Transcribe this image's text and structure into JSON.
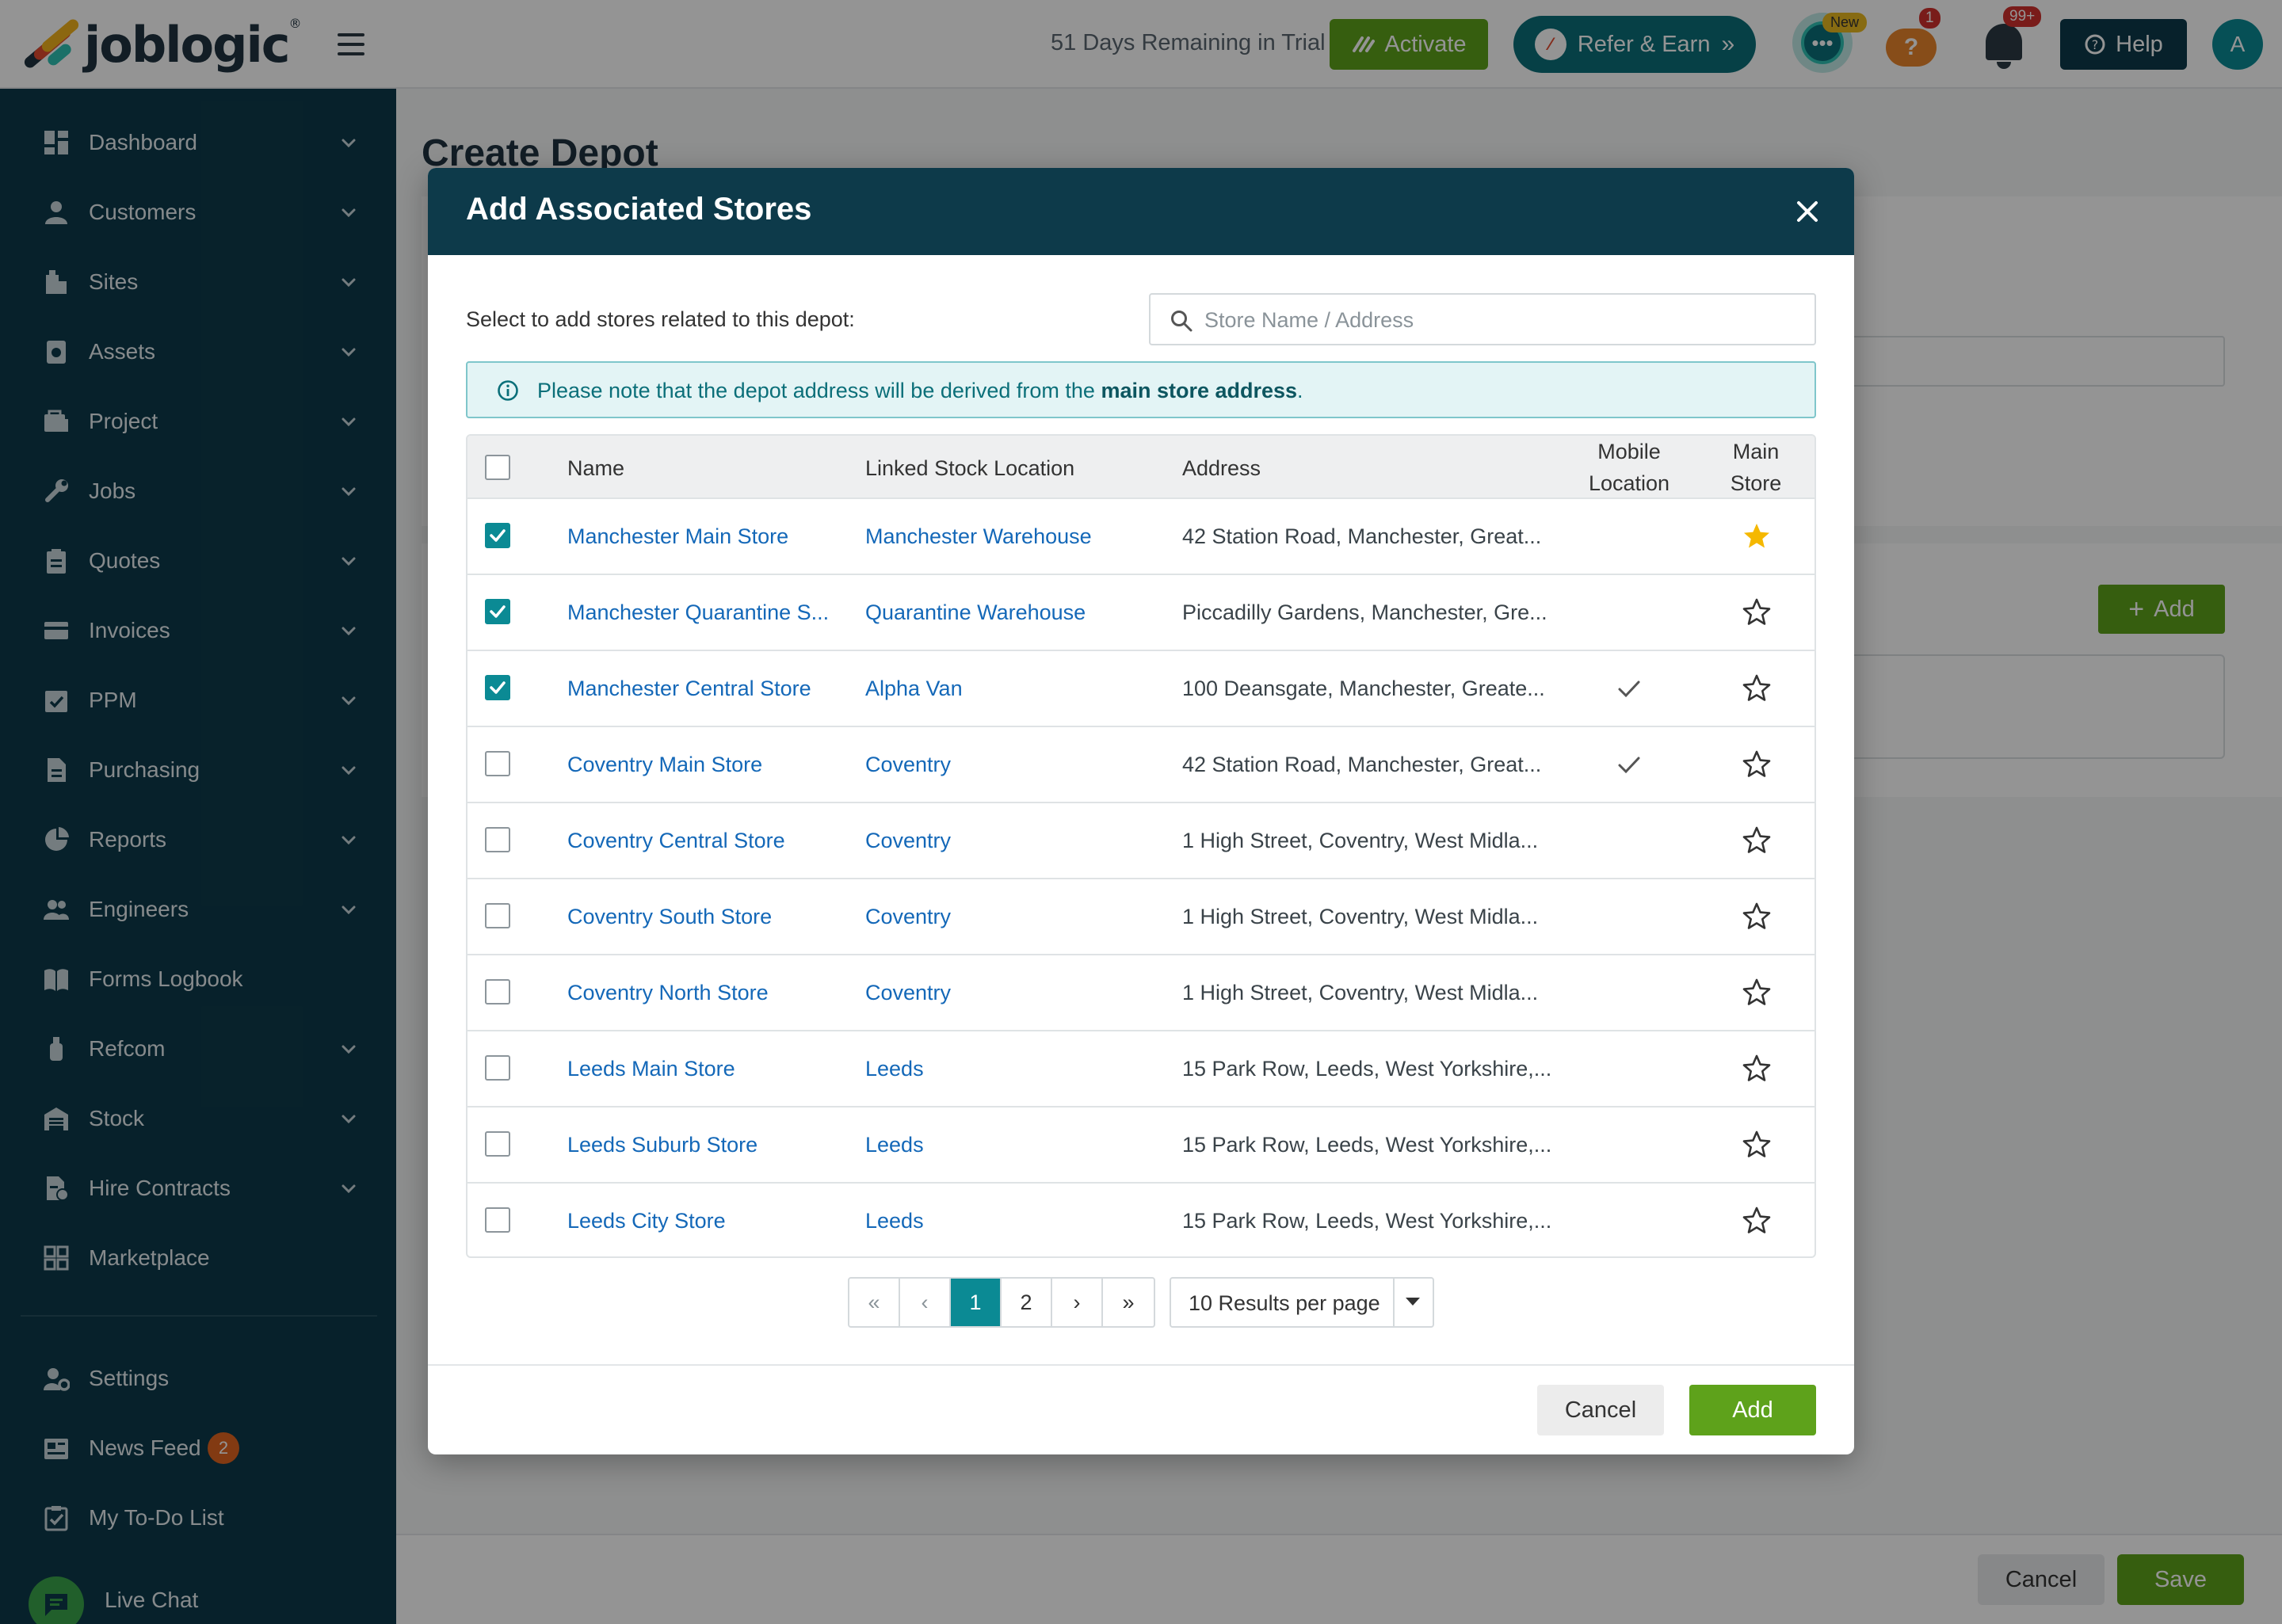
{
  "app": {
    "logo_text": "joblogic",
    "logo_registered": "®"
  },
  "topbar": {
    "trial_text": "51 Days Remaining in Trial",
    "activate_label": "Activate",
    "refer_label": "Refer & Earn",
    "chat_new_badge": "New",
    "help_count": "1",
    "notifications_count": "99+",
    "help_label": "Help",
    "avatar_initial": "A"
  },
  "sidebar": {
    "items": [
      {
        "label": "Dashboard",
        "icon": "dashboard-icon",
        "chevron": true
      },
      {
        "label": "Customers",
        "icon": "person-icon",
        "chevron": true
      },
      {
        "label": "Sites",
        "icon": "building-icon",
        "chevron": true
      },
      {
        "label": "Assets",
        "icon": "asset-icon",
        "chevron": true
      },
      {
        "label": "Project",
        "icon": "project-icon",
        "chevron": true
      },
      {
        "label": "Jobs",
        "icon": "wrench-icon",
        "chevron": true
      },
      {
        "label": "Quotes",
        "icon": "clipboard-icon",
        "chevron": true
      },
      {
        "label": "Invoices",
        "icon": "card-icon",
        "chevron": true
      },
      {
        "label": "PPM",
        "icon": "calendar-check-icon",
        "chevron": true
      },
      {
        "label": "Purchasing",
        "icon": "document-icon",
        "chevron": true
      },
      {
        "label": "Reports",
        "icon": "pie-chart-icon",
        "chevron": true
      },
      {
        "label": "Engineers",
        "icon": "people-icon",
        "chevron": true
      },
      {
        "label": "Forms Logbook",
        "icon": "book-icon",
        "chevron": false
      },
      {
        "label": "Refcom",
        "icon": "cylinder-icon",
        "chevron": true
      },
      {
        "label": "Stock",
        "icon": "warehouse-icon",
        "chevron": true
      },
      {
        "label": "Hire Contracts",
        "icon": "contract-icon",
        "chevron": true
      },
      {
        "label": "Marketplace",
        "icon": "grid-icon",
        "chevron": false
      }
    ],
    "bottom_items": [
      {
        "label": "Settings",
        "icon": "settings-icon"
      },
      {
        "label": "News Feed",
        "icon": "news-icon",
        "badge": "2"
      },
      {
        "label": "My To-Do List",
        "icon": "todo-icon"
      }
    ],
    "live_chat_label": "Live Chat"
  },
  "page": {
    "title": "Create Depot",
    "add_label": "Add",
    "cancel_label": "Cancel",
    "save_label": "Save"
  },
  "modal": {
    "title": "Add Associated Stores",
    "select_label": "Select to add stores related to this depot:",
    "search_placeholder": "Store Name / Address",
    "search_value": "",
    "notice_prefix": "Please note that the depot address will be derived from the ",
    "notice_bold": "main store address",
    "notice_suffix": ".",
    "columns": {
      "name": "Name",
      "linked": "Linked Stock Location",
      "address": "Address",
      "mobile_line1": "Mobile",
      "mobile_line2": "Location",
      "main_line1": "Main",
      "main_line2": "Store"
    },
    "rows": [
      {
        "checked": true,
        "name": "Manchester Main Store",
        "linked": "Manchester Warehouse",
        "address": "42 Station Road, Manchester, Great...",
        "mobile": false,
        "main": true
      },
      {
        "checked": true,
        "name": "Manchester Quarantine S...",
        "linked": "Quarantine Warehouse",
        "address": "Piccadilly Gardens, Manchester, Gre...",
        "mobile": false,
        "main": false
      },
      {
        "checked": true,
        "name": "Manchester Central Store",
        "linked": "Alpha Van",
        "address": "100 Deansgate, Manchester, Greate...",
        "mobile": true,
        "main": false
      },
      {
        "checked": false,
        "name": "Coventry Main Store",
        "linked": "Coventry",
        "address": "42 Station Road, Manchester, Great...",
        "mobile": true,
        "main": false
      },
      {
        "checked": false,
        "name": "Coventry Central Store",
        "linked": "Coventry",
        "address": "1 High Street, Coventry, West Midla...",
        "mobile": false,
        "main": false
      },
      {
        "checked": false,
        "name": "Coventry South Store",
        "linked": "Coventry",
        "address": "1 High Street, Coventry, West Midla...",
        "mobile": false,
        "main": false
      },
      {
        "checked": false,
        "name": "Coventry North Store",
        "linked": "Coventry",
        "address": "1 High Street, Coventry, West Midla...",
        "mobile": false,
        "main": false
      },
      {
        "checked": false,
        "name": "Leeds Main Store",
        "linked": "Leeds",
        "address": "15 Park Row, Leeds, West Yorkshire,...",
        "mobile": false,
        "main": false
      },
      {
        "checked": false,
        "name": "Leeds Suburb Store",
        "linked": "Leeds",
        "address": "15 Park Row, Leeds, West Yorkshire,...",
        "mobile": false,
        "main": false
      },
      {
        "checked": false,
        "name": "Leeds City Store",
        "linked": "Leeds",
        "address": "15 Park Row, Leeds, West Yorkshire,...",
        "mobile": false,
        "main": false
      }
    ],
    "pagination": {
      "pages": [
        "1",
        "2"
      ],
      "current_page": "1",
      "per_page_label": "10 Results per page"
    },
    "cancel_label": "Cancel",
    "add_label": "Add"
  },
  "colors": {
    "sidebar_bg": "#0d3a4a",
    "primary_teal": "#0b8a94",
    "action_green": "#5ea21b",
    "link_blue": "#1468b8",
    "star_gold": "#f5b800"
  }
}
